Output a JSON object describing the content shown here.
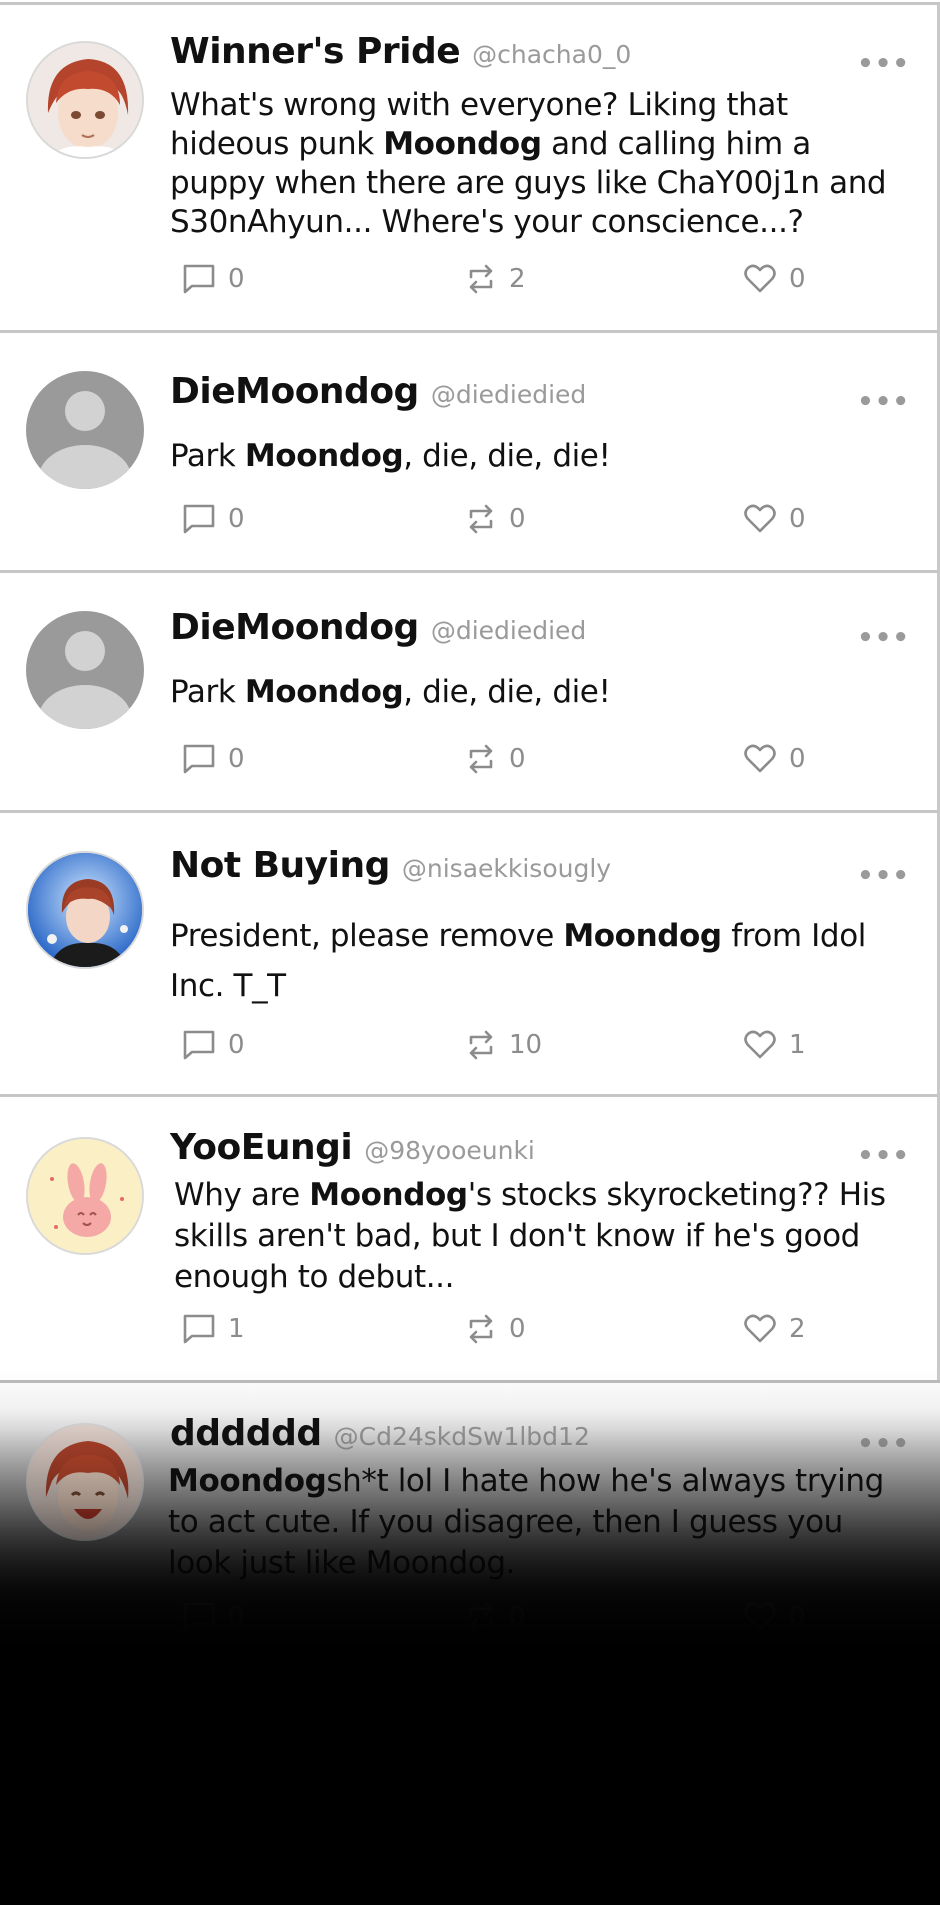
{
  "posts": [
    {
      "display_name": "Winner's Pride",
      "handle": "@chacha0_0",
      "text_parts": [
        "What's wrong with everyone? Liking that hideous punk ",
        "Moondog",
        " and calling him a puppy when there are guys like ChaY00j1n and S30nAhyun... Where's your conscience...?"
      ],
      "replies": "0",
      "retweets": "2",
      "likes": "0",
      "avatar": "red-hair-boy-avatar"
    },
    {
      "display_name": "DieMoondog",
      "handle": "@diediedied",
      "text_parts": [
        "Park ",
        "Moondog",
        ", die, die, die!"
      ],
      "replies": "0",
      "retweets": "0",
      "likes": "0",
      "avatar": "default-user-avatar"
    },
    {
      "display_name": "DieMoondog",
      "handle": "@diediedied",
      "text_parts": [
        "Park ",
        "Moondog",
        ", die, die, die!"
      ],
      "replies": "0",
      "retweets": "0",
      "likes": "0",
      "avatar": "default-user-avatar"
    },
    {
      "display_name": "Not Buying",
      "handle": "@nisaekkisougly",
      "text_parts": [
        "President, please remove ",
        "Moondog",
        " from Idol Inc. T_T"
      ],
      "replies": "0",
      "retweets": "10",
      "likes": "1",
      "avatar": "idol-portrait-avatar"
    },
    {
      "display_name": "YooEungi",
      "handle": "@98yooeunki",
      "text_parts": [
        "Why are ",
        "Moondog",
        "'s stocks skyrocketing?? His skills aren't bad, but I don't know if he's good enough to debut..."
      ],
      "replies": "1",
      "retweets": "0",
      "likes": "2",
      "avatar": "pink-bunny-avatar"
    },
    {
      "display_name": "dddddd",
      "handle": "@Cd24skdSw1lbd12",
      "text_parts": [
        "",
        "Moondog",
        "sh*t lol I hate how he's always trying to act cute. If you disagree, then I guess you look just like Moondog."
      ],
      "replies": "0",
      "retweets": "0",
      "likes": "0",
      "avatar": "laughing-boy-avatar"
    }
  ],
  "icons": {
    "reply": "reply-icon",
    "retweet": "retweet-icon",
    "like": "heart-icon",
    "more": "more-options-icon"
  },
  "more_glyph": "•••",
  "colors": {
    "text": "#111111",
    "muted": "#8c8c8c",
    "divider": "#c6c6c6"
  }
}
